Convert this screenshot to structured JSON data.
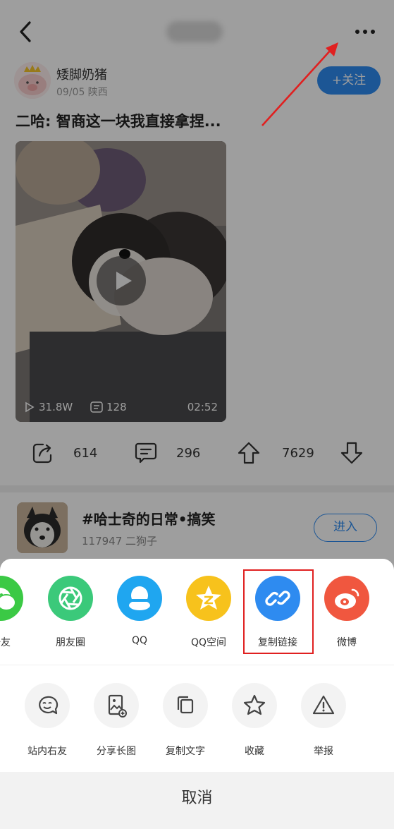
{
  "author": {
    "name": "矮脚奶猪",
    "meta": "09/05 陕西",
    "follow_label": "+关注"
  },
  "post": {
    "title": "二哈: 智商这一块我直接拿捏...",
    "video": {
      "views": "31.8W",
      "comments": "128",
      "duration": "02:52"
    },
    "actions": {
      "shares": "614",
      "comments": "296",
      "likes": "7629"
    }
  },
  "topic": {
    "name": "#哈士奇的日常•搞笑",
    "meta": "117947 二狗子",
    "enter_label": "进入"
  },
  "share_sheet": {
    "share_items": [
      {
        "label": "好友",
        "icon": "wechat-icon",
        "color": "#3bc945"
      },
      {
        "label": "朋友圈",
        "icon": "moments-icon",
        "color": "#3bc97a"
      },
      {
        "label": "QQ",
        "icon": "qq-icon",
        "color": "#1fa6f0"
      },
      {
        "label": "QQ空间",
        "icon": "qzone-icon",
        "color": "#f7c21c"
      },
      {
        "label": "复制链接",
        "icon": "link-icon",
        "color": "#2e8bf0"
      },
      {
        "label": "微博",
        "icon": "weibo-icon",
        "color": "#f0573f"
      }
    ],
    "tool_items": [
      {
        "label": "站内右友",
        "icon": "smile-icon"
      },
      {
        "label": "分享长图",
        "icon": "long-image-icon"
      },
      {
        "label": "复制文字",
        "icon": "copy-icon"
      },
      {
        "label": "收藏",
        "icon": "star-icon"
      },
      {
        "label": "举报",
        "icon": "warning-icon"
      }
    ],
    "cancel_label": "取消"
  },
  "colors": {
    "accent": "#2e8bf0",
    "annotation": "#e02020"
  }
}
